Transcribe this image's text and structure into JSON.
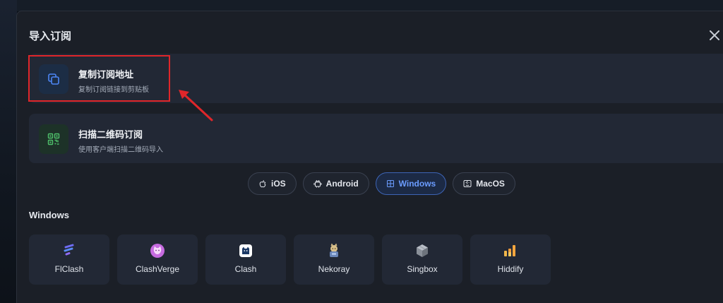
{
  "modal": {
    "title": "导入订阅"
  },
  "options": [
    {
      "title": "复制订阅地址",
      "subtitle": "复制订阅链接到剪贴板",
      "icon": "copy-icon"
    },
    {
      "title": "扫描二维码订阅",
      "subtitle": "使用客户端扫描二维码导入",
      "icon": "qrcode-icon"
    }
  ],
  "tabs": [
    {
      "label": "iOS",
      "icon": "apple-icon",
      "active": false
    },
    {
      "label": "Android",
      "icon": "android-icon",
      "active": false
    },
    {
      "label": "Windows",
      "icon": "windows-icon",
      "active": true
    },
    {
      "label": "MacOS",
      "icon": "macos-icon",
      "active": false
    }
  ],
  "section": {
    "label": "Windows"
  },
  "clients": [
    {
      "name": "FlClash",
      "icon": "flclash-icon"
    },
    {
      "name": "ClashVerge",
      "icon": "clashverge-icon"
    },
    {
      "name": "Clash",
      "icon": "clash-icon"
    },
    {
      "name": "Nekoray",
      "icon": "nekoray-icon"
    },
    {
      "name": "Singbox",
      "icon": "singbox-icon"
    },
    {
      "name": "Hiddify",
      "icon": "hiddify-icon"
    }
  ],
  "colors": {
    "accent": "#6b9cff",
    "highlight": "#e0262a",
    "qr_green": "#4fc06b"
  }
}
